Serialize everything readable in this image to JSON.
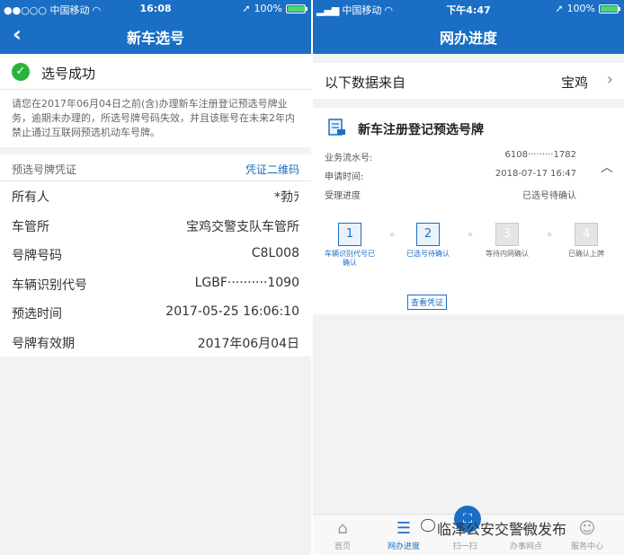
{
  "left": {
    "status": {
      "carrier": "●●○○○ 中国移动",
      "time": "16:08",
      "battery": "100%",
      "battery_level": 1.0
    },
    "nav": {
      "title": "新车选号",
      "back_icon": "chevron-left-icon"
    },
    "success": {
      "title": "选号成功",
      "icon": "check-circle-icon",
      "notice": "请您在2017年06月04日之前(含)办理新车注册登记预选号牌业务，逾期未办理的，所选号牌号码失效，并且该账号在未来2年内禁止通过互联网预选机动车号牌。"
    },
    "plate": {
      "header_label": "预选号牌凭证",
      "qr_link": "凭证二维码",
      "rows": [
        {
          "key": "所有人",
          "value": "*勃ﾗ"
        },
        {
          "key": "车管所",
          "value": "宝鸡交警支队车管所"
        },
        {
          "key": "号牌号码",
          "value": "C8L008"
        },
        {
          "key": "车辆识别代号",
          "value": "LGBF··········1090"
        },
        {
          "key": "预选时间",
          "value": "2017-05-25 16:06:10"
        },
        {
          "key": "号牌有效期",
          "value": "2017年06月04日"
        }
      ]
    }
  },
  "right": {
    "status": {
      "carrier": "中国移动",
      "time": "下午4:47",
      "battery": "100%",
      "battery_level": 1.0
    },
    "nav": {
      "title": "网办进度"
    },
    "source": {
      "label": "以下数据来自",
      "value": "宝鸡"
    },
    "detail": {
      "title": "新车注册登记预选号牌",
      "rows": [
        {
          "key": "业务流水号:",
          "value": "6108·········1782"
        },
        {
          "key": "申请时间:",
          "value": "2018-07-17 16:47"
        },
        {
          "key": "受理进度",
          "value": "已选号待确认"
        }
      ],
      "steps": [
        {
          "num": "1",
          "label": "车辆识别代号已确认",
          "active": true
        },
        {
          "num": "2",
          "label": "已选号待确认",
          "active": true
        },
        {
          "num": "3",
          "label": "等待内网确认",
          "active": false
        },
        {
          "num": "4",
          "label": "已确认上牌",
          "active": false
        }
      ],
      "voucher_button": "查看凭证"
    },
    "tabs": [
      {
        "label": "首页",
        "icon": "home-icon"
      },
      {
        "label": "网办进度",
        "icon": "progress-list-icon"
      },
      {
        "label": "扫一扫",
        "icon": "scan-icon"
      },
      {
        "label": "办事网点",
        "icon": "location-icon"
      },
      {
        "label": "服务中心",
        "icon": "service-icon"
      }
    ],
    "active_tab": "网办进度",
    "watermark": "临泽公安交警微发布"
  },
  "colors": {
    "primary": "#1a6fc4",
    "success": "#2bb23c",
    "background": "#f2f2f4"
  }
}
